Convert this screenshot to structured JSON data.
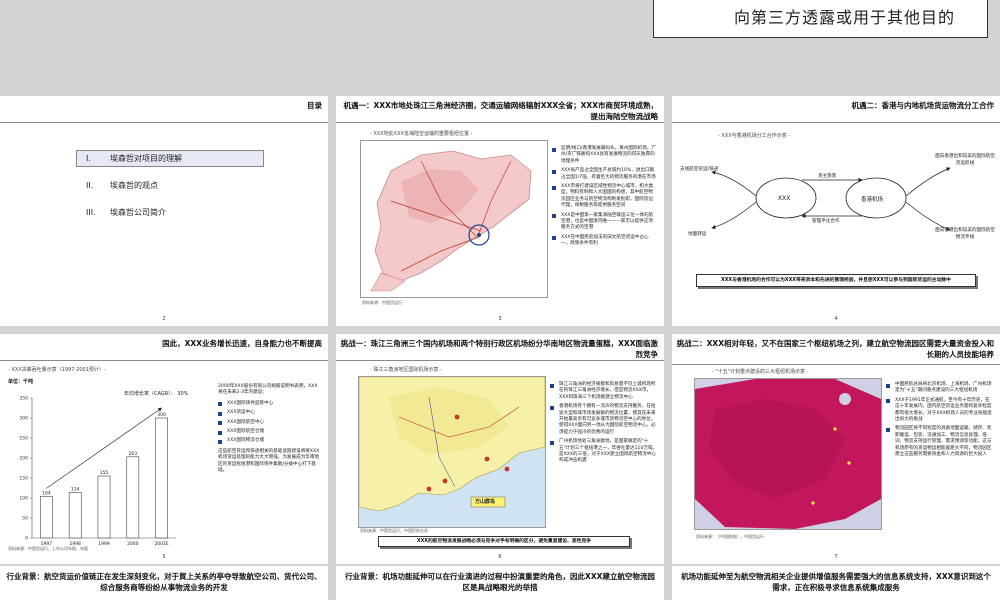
{
  "banner": "向第三方透露或用于其他目的",
  "slides": {
    "s1": {
      "header": "目录",
      "items": [
        {
          "num": "I.",
          "label": "埃森哲对项目的理解"
        },
        {
          "num": "II.",
          "label": "埃森哲的观点"
        },
        {
          "num": "III.",
          "label": "埃森哲公司简介"
        }
      ],
      "page": "2"
    },
    "s2": {
      "header": "机遇一：XXX市地处珠江三角洲经济圈，交通运输网络辐射XXX全省；XXX市商贸环境成熟，提出海陆空物流战略",
      "map_caption": "- XXX地处XXX省海陆空运输的重要枢纽位置 -",
      "bullets": [
        "监明/栈口/香港发展箱码头，黄州国际机场，广州/京广铁路和XXX具有发展物流的得天独厚的地理条件",
        "XXX省产品占全国生产总值约10%，进出口额占全国1/7强，有着巨大的物流服务的潜在市场",
        "XXX市将打建设区域性物流中心城市，构大类型，物料有制和入大国国的构想，其中航空物流园区业务与航空物流构制发批职，国际贸边代理，保税服务等提供服务空间",
        "XXX是中国第一家集海陆空联运三位一体的航空港，也是中国境内唯一——家可以提供这项服务方式的空港",
        "XXX在中国民航加法的旧文航空货运中占心一，政策条件有利"
      ],
      "source": "资料来源：中国货运行",
      "page": "3"
    },
    "s3": {
      "header": "机遇二：香港与内地机场货运物流分工合作",
      "caption": "- XXX与香港机场分工合作示意 -",
      "node_left": "XXX",
      "node_right": "香港机场",
      "arrow_top": "货主旅客",
      "arrow_bottom": "管理平化合作",
      "left_top": "支线航空货运/快递",
      "left_bottom": "地面转运",
      "right_top": "面向香港出和较美的国际航空货运航线",
      "right_bottom": "面向香港出和较美的国际航空物流专线",
      "footer_box": "XXX与香港机场的合作可以为XXX带来资本和先进的管理经验，并且使XXX可以参与到国际货运的主动脉中",
      "page": "4"
    },
    "s4": {
      "header": "国此，XXX业务增长迅速，自身能力也不断提高",
      "chart_caption": "- XXX货邮吞吐量示意（1997-2001预计）-",
      "unit": "单位：千吨",
      "cagr_label": "年均增长率（CAGR）：",
      "cagr_value": "30%",
      "intro": "2000年XXX股份有限公司规股说明书表明，XXX将在未来2-3年内建设：",
      "list": [
        "XXX国际快件监管中心",
        "XXX货运中心",
        "XXX国际航空中心",
        "XXX国际航空仓储",
        "XXX国际物流仓储"
      ],
      "summary": "这些航空货运和快递相关的基础设施建设将将XXX机场货运处理的能力大大增强，为发展成为华南地区的货运枢纽港和国际快件集散/分拨中心打下基础。",
      "source": "资料来源：中国货运行、上市公司年报、年报",
      "page": "5"
    },
    "s5": {
      "header": "挑战一：珠江三角洲三个国内机场和两个特别行政区机场纷分华南地区物流量蛋糕，XXX面临激烈竞争",
      "map_caption": "- 珠江三角洲地区国际机场示意 -",
      "map_label": "万山群岛",
      "bullets": [
        "珠江三角洲的经济规模和贸易量不仅上城机场所在的珠江三角洲经济增长，但是物流XXX市，XXX和珠海三个机场能建立物流中心",
        "香港机场有个拥有一流声的物流支持服务，在短途大型和域市场发展额的物流位置，使其在未来开始最高亲有可竞争城市货物流空中心的地位，使得XXX面向另一地从为国际航空物流中心，必须提力于强冷的优秀的运行",
        "广州机场地处三角洲腹地，是国家确定的\"十五\"计划三个枢纽港之一，年吞吐量达110万吨，是XXX的三倍，对于XXX建立国际航空物流中心构成冲击机遇"
      ],
      "footer_box": "XXX的航空物流发展战略必须与竞争对手有明确的区分，避免重复建设、恶性竞争",
      "source": "资料来源：中国货运行，中国民航业务",
      "page": "6"
    },
    "s6": {
      "header": "挑战二：XXX相对年轻，又不在国家三个枢纽机场之列，建立航空物流园区需要大量资金投入和长期的人员技能培养",
      "map_caption": "- \"十五\"计划重点建设的三大枢纽机场示意 -",
      "bullets": [
        "中国民航总局将北京机场、上海机场、广州机场定为\"十五\"期间重点建设的三大枢纽机场",
        "XXX于1991年正式通航，至今有十年历史，在这十年发展内，国内航空货运业务量和复杂程度都有很大增长，对于XXX机场人员的专业技能提出很大的挑战",
        "物流园区将不同程度的具备地面运输、储存、装卸搬运、包装、流通加工、物流信息处理、培训、物流支持运行管理、需求预测等功能。这与机场原有的货运物运相能差距大不同，物流园区建立这些服务需要资金和人力资源的巨大投入"
      ],
      "source": "资料来源：《中国航线》，中国货运行",
      "page": "7"
    },
    "b1": "行业背景：航空货运价值链正在发生深刻变化，对于貿上关系的亭夺导致航空公司、货代公司、综合服务商等纷纷从事物流业务的开发",
    "b2": "行业背景：机场功能延伸可以在行业演进的过程中扮演重要的角色，因此XXX建立航空物流园区是具战略眼光的举措",
    "b3": "机场功能延伸至为航空物流相关企业提供增值服务需要强大的信息系统支持，XXX意识到这个需求，正在积极寻求信息系统集成服务"
  },
  "chart_data": {
    "type": "bar",
    "title": "XXX货邮吞吐量示意（1997-2001预计）",
    "ylabel": "单位：千吨",
    "categories": [
      "1997",
      "1998",
      "1999",
      "2000",
      "2001E"
    ],
    "values": [
      104,
      114,
      155,
      203,
      300
    ],
    "ylim": [
      0,
      350
    ],
    "yticks": [
      0,
      50,
      100,
      150,
      200,
      250,
      300,
      350
    ],
    "grid": false,
    "annotation": "年均增长率（CAGR）：30%"
  }
}
